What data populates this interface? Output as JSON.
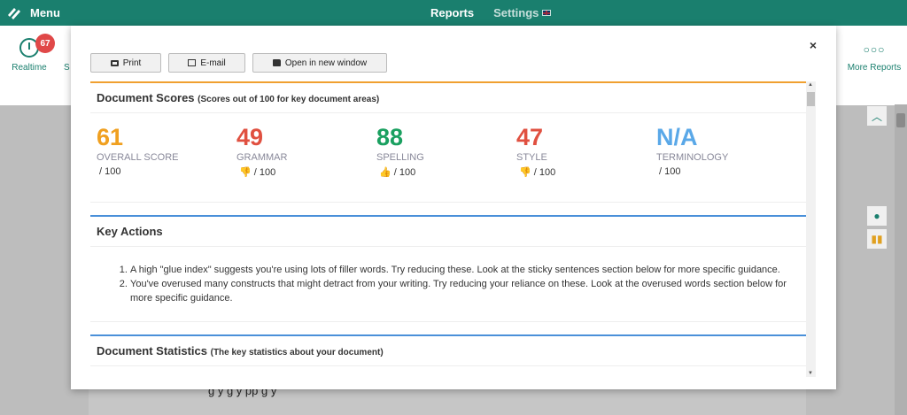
{
  "topbar": {
    "menu_label": "Menu",
    "reports_label": "Reports",
    "settings_label": "Settings"
  },
  "toolbar": {
    "realtime_label": "Realtime",
    "realtime_badge": "67",
    "s_label": "S",
    "more_label": "More Reports"
  },
  "background": {
    "partial_text": "g           y          g           y                                                   pp          g      y"
  },
  "modal": {
    "close_label": "×",
    "buttons": {
      "print": "Print",
      "email": "E-mail",
      "open": "Open in new window"
    },
    "scores_section": {
      "title": "Document Scores",
      "subtitle": "(Scores out of 100 for key document areas)",
      "items": [
        {
          "value": "61",
          "label": "OVERALL SCORE",
          "out_of": "/ 100",
          "color": "#f0a020",
          "thumb": ""
        },
        {
          "value": "49",
          "label": "GRAMMAR",
          "out_of": "/ 100",
          "color": "#e05040",
          "thumb": "down"
        },
        {
          "value": "88",
          "label": "SPELLING",
          "out_of": "/ 100",
          "color": "#1aa060",
          "thumb": "up"
        },
        {
          "value": "47",
          "label": "STYLE",
          "out_of": "/ 100",
          "color": "#e05040",
          "thumb": "down"
        },
        {
          "value": "N/A",
          "label": "TERMINOLOGY",
          "out_of": "/ 100",
          "color": "#5aa8e8",
          "thumb": ""
        }
      ]
    },
    "actions_section": {
      "title": "Key Actions",
      "items": [
        "A high \"glue index\" suggests you're using lots of filler words. Try reducing these. Look at the sticky sentences section below for more specific guidance.",
        "You've overused many constructs that might detract from your writing. Try reducing your reliance on these. Look at the overused words section below for more specific guidance."
      ]
    },
    "stats_section": {
      "title": "Document Statistics",
      "subtitle": "(The key statistics about your document)"
    }
  }
}
